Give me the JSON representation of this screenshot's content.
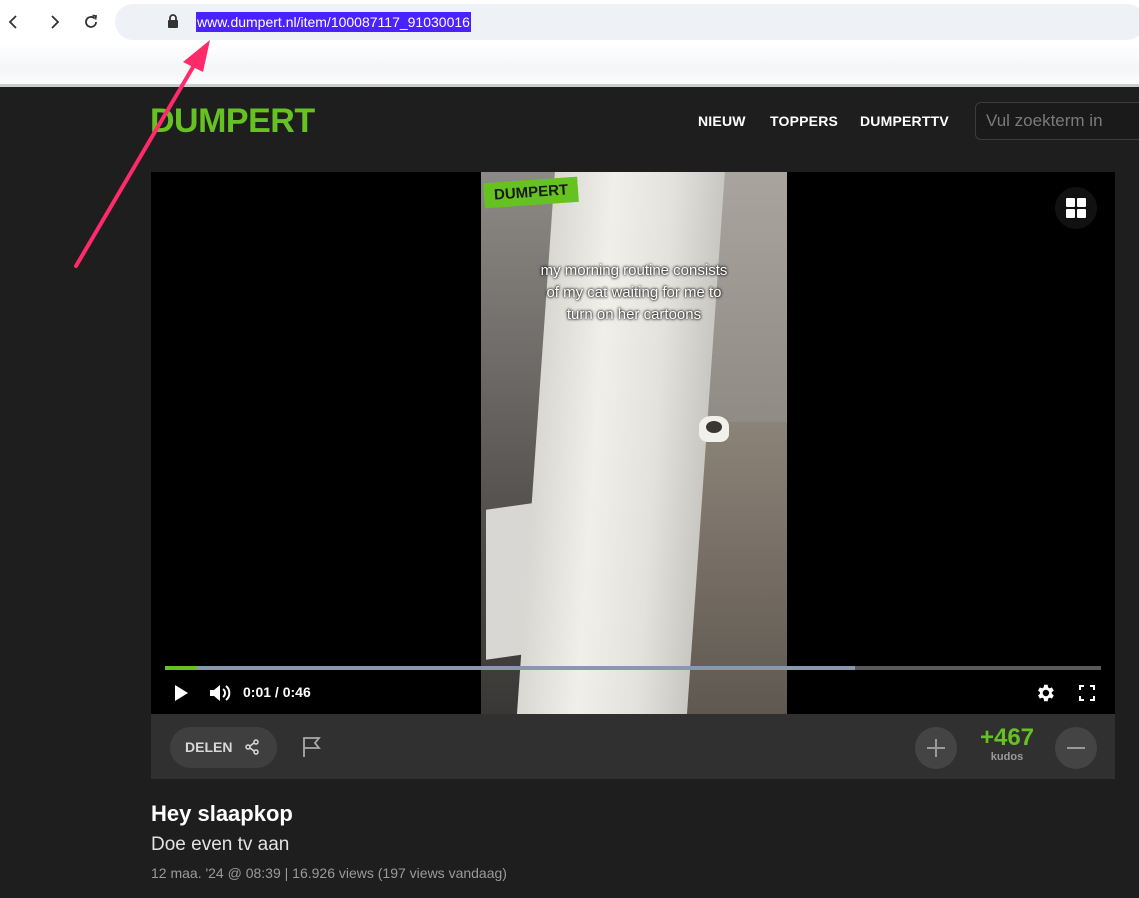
{
  "browser": {
    "url": "www.dumpert.nl/item/100087117_91030016"
  },
  "site": {
    "logo": "DUMPERT",
    "nav": [
      "NIEUW",
      "TOPPERS",
      "DUMPERTTV"
    ],
    "search_placeholder": "Vul zoekterm in"
  },
  "player": {
    "watermark": "DUMPERT",
    "caption_lines": [
      "my morning routine consists",
      "of my cat waiting for me to",
      "turn on her cartoons"
    ],
    "current_time": "0:01",
    "separator": "/",
    "duration": "0:46",
    "progress_fraction": 0.034,
    "buffered_fraction": 0.737,
    "icons": [
      "play-icon",
      "volume-icon",
      "settings-gear-icon",
      "fullscreen-icon",
      "grid-icon"
    ]
  },
  "actions": {
    "share_label": "DELEN",
    "kudos_value": "+467",
    "kudos_label": "kudos"
  },
  "item": {
    "title": "Hey slaapkop",
    "subtitle": "Doe even tv aan",
    "meta": "12 maa. '24 @ 08:39 | 16.926 views (197 views vandaag)"
  },
  "colors": {
    "brand_green": "#66c221",
    "background": "#1e1e1e",
    "url_highlight": "#4a22ff",
    "annotation_arrow": "#ff2a6a"
  }
}
